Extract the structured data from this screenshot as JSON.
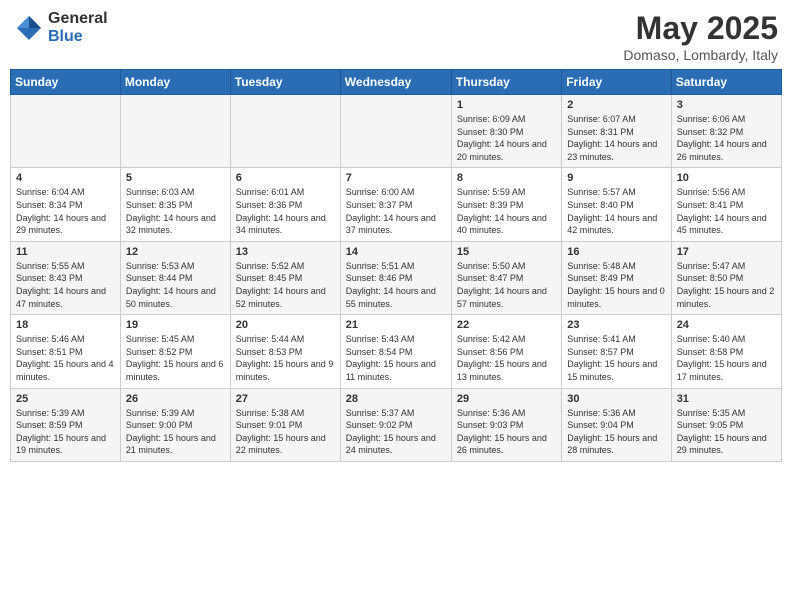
{
  "logo": {
    "general": "General",
    "blue": "Blue"
  },
  "title": "May 2025",
  "subtitle": "Domaso, Lombardy, Italy",
  "days_of_week": [
    "Sunday",
    "Monday",
    "Tuesday",
    "Wednesday",
    "Thursday",
    "Friday",
    "Saturday"
  ],
  "weeks": [
    [
      {
        "day": "",
        "info": ""
      },
      {
        "day": "",
        "info": ""
      },
      {
        "day": "",
        "info": ""
      },
      {
        "day": "",
        "info": ""
      },
      {
        "day": "1",
        "info": "Sunrise: 6:09 AM\nSunset: 8:30 PM\nDaylight: 14 hours and 20 minutes."
      },
      {
        "day": "2",
        "info": "Sunrise: 6:07 AM\nSunset: 8:31 PM\nDaylight: 14 hours and 23 minutes."
      },
      {
        "day": "3",
        "info": "Sunrise: 6:06 AM\nSunset: 8:32 PM\nDaylight: 14 hours and 26 minutes."
      }
    ],
    [
      {
        "day": "4",
        "info": "Sunrise: 6:04 AM\nSunset: 8:34 PM\nDaylight: 14 hours and 29 minutes."
      },
      {
        "day": "5",
        "info": "Sunrise: 6:03 AM\nSunset: 8:35 PM\nDaylight: 14 hours and 32 minutes."
      },
      {
        "day": "6",
        "info": "Sunrise: 6:01 AM\nSunset: 8:36 PM\nDaylight: 14 hours and 34 minutes."
      },
      {
        "day": "7",
        "info": "Sunrise: 6:00 AM\nSunset: 8:37 PM\nDaylight: 14 hours and 37 minutes."
      },
      {
        "day": "8",
        "info": "Sunrise: 5:59 AM\nSunset: 8:39 PM\nDaylight: 14 hours and 40 minutes."
      },
      {
        "day": "9",
        "info": "Sunrise: 5:57 AM\nSunset: 8:40 PM\nDaylight: 14 hours and 42 minutes."
      },
      {
        "day": "10",
        "info": "Sunrise: 5:56 AM\nSunset: 8:41 PM\nDaylight: 14 hours and 45 minutes."
      }
    ],
    [
      {
        "day": "11",
        "info": "Sunrise: 5:55 AM\nSunset: 8:43 PM\nDaylight: 14 hours and 47 minutes."
      },
      {
        "day": "12",
        "info": "Sunrise: 5:53 AM\nSunset: 8:44 PM\nDaylight: 14 hours and 50 minutes."
      },
      {
        "day": "13",
        "info": "Sunrise: 5:52 AM\nSunset: 8:45 PM\nDaylight: 14 hours and 52 minutes."
      },
      {
        "day": "14",
        "info": "Sunrise: 5:51 AM\nSunset: 8:46 PM\nDaylight: 14 hours and 55 minutes."
      },
      {
        "day": "15",
        "info": "Sunrise: 5:50 AM\nSunset: 8:47 PM\nDaylight: 14 hours and 57 minutes."
      },
      {
        "day": "16",
        "info": "Sunrise: 5:48 AM\nSunset: 8:49 PM\nDaylight: 15 hours and 0 minutes."
      },
      {
        "day": "17",
        "info": "Sunrise: 5:47 AM\nSunset: 8:50 PM\nDaylight: 15 hours and 2 minutes."
      }
    ],
    [
      {
        "day": "18",
        "info": "Sunrise: 5:46 AM\nSunset: 8:51 PM\nDaylight: 15 hours and 4 minutes."
      },
      {
        "day": "19",
        "info": "Sunrise: 5:45 AM\nSunset: 8:52 PM\nDaylight: 15 hours and 6 minutes."
      },
      {
        "day": "20",
        "info": "Sunrise: 5:44 AM\nSunset: 8:53 PM\nDaylight: 15 hours and 9 minutes."
      },
      {
        "day": "21",
        "info": "Sunrise: 5:43 AM\nSunset: 8:54 PM\nDaylight: 15 hours and 11 minutes."
      },
      {
        "day": "22",
        "info": "Sunrise: 5:42 AM\nSunset: 8:56 PM\nDaylight: 15 hours and 13 minutes."
      },
      {
        "day": "23",
        "info": "Sunrise: 5:41 AM\nSunset: 8:57 PM\nDaylight: 15 hours and 15 minutes."
      },
      {
        "day": "24",
        "info": "Sunrise: 5:40 AM\nSunset: 8:58 PM\nDaylight: 15 hours and 17 minutes."
      }
    ],
    [
      {
        "day": "25",
        "info": "Sunrise: 5:39 AM\nSunset: 8:59 PM\nDaylight: 15 hours and 19 minutes."
      },
      {
        "day": "26",
        "info": "Sunrise: 5:39 AM\nSunset: 9:00 PM\nDaylight: 15 hours and 21 minutes."
      },
      {
        "day": "27",
        "info": "Sunrise: 5:38 AM\nSunset: 9:01 PM\nDaylight: 15 hours and 22 minutes."
      },
      {
        "day": "28",
        "info": "Sunrise: 5:37 AM\nSunset: 9:02 PM\nDaylight: 15 hours and 24 minutes."
      },
      {
        "day": "29",
        "info": "Sunrise: 5:36 AM\nSunset: 9:03 PM\nDaylight: 15 hours and 26 minutes."
      },
      {
        "day": "30",
        "info": "Sunrise: 5:36 AM\nSunset: 9:04 PM\nDaylight: 15 hours and 28 minutes."
      },
      {
        "day": "31",
        "info": "Sunrise: 5:35 AM\nSunset: 9:05 PM\nDaylight: 15 hours and 29 minutes."
      }
    ]
  ]
}
